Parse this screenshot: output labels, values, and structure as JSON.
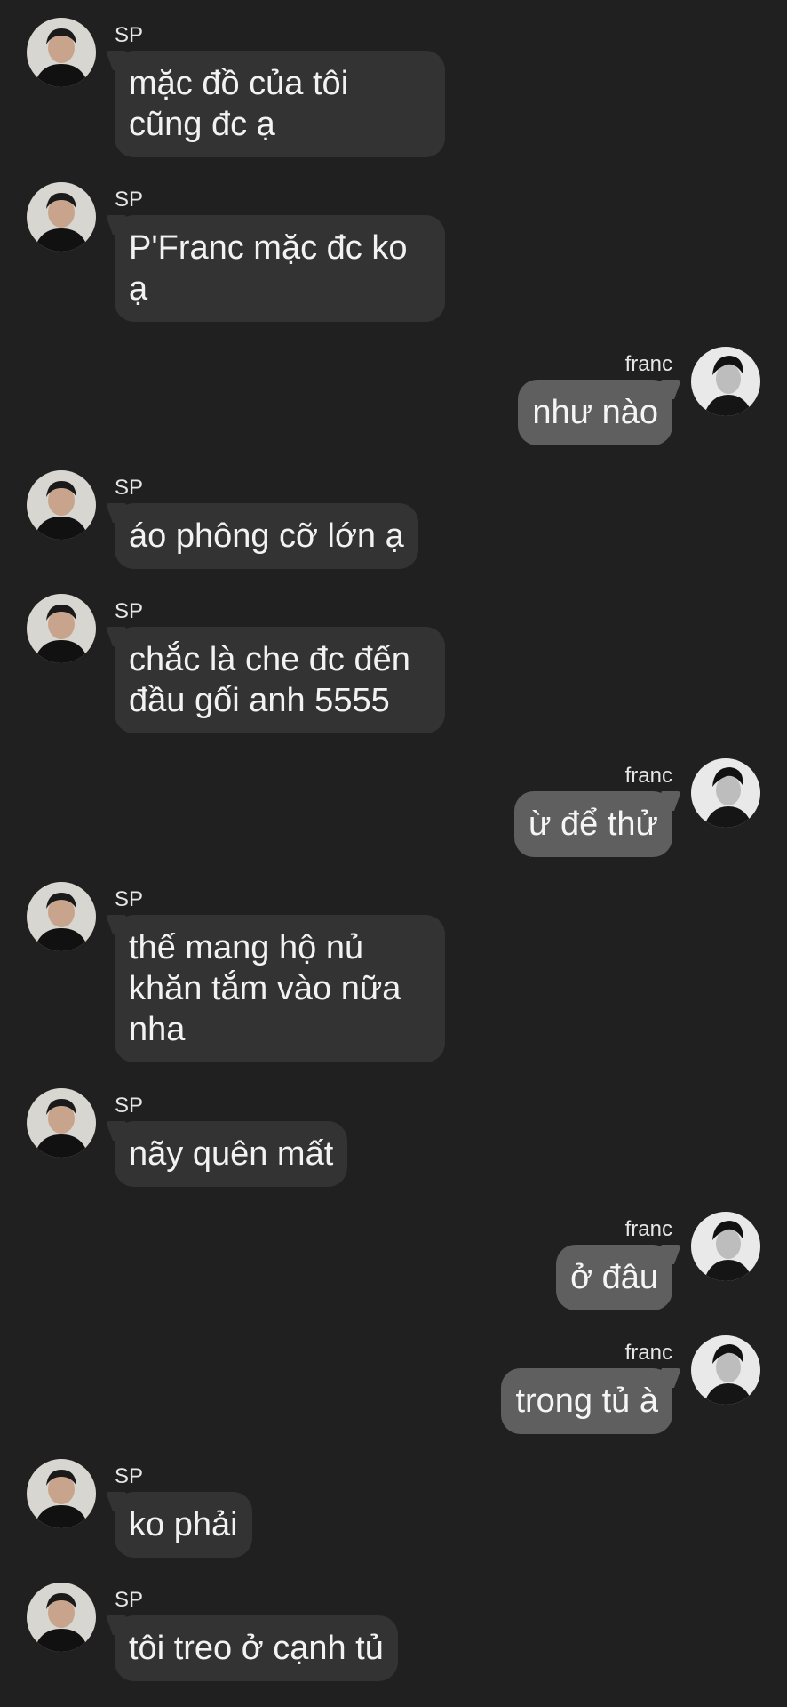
{
  "users": {
    "sp": {
      "name": "SP",
      "avatar_icon": "sp-avatar-photo"
    },
    "franc": {
      "name": "franc",
      "avatar_icon": "franc-avatar-photo"
    }
  },
  "messages": [
    {
      "from": "SP",
      "text": "mặc đồ của tôi cũng đc ạ"
    },
    {
      "from": "SP",
      "text": "P'Franc mặc đc ko ạ"
    },
    {
      "from": "franc",
      "text": "như nào"
    },
    {
      "from": "SP",
      "text": "áo phông cỡ lớn ạ"
    },
    {
      "from": "SP",
      "text": "chắc là che đc đến đầu gối anh 5555"
    },
    {
      "from": "franc",
      "text": "ừ để thử"
    },
    {
      "from": "SP",
      "text": "thế mang hộ nủ khăn tắm vào nữa nha"
    },
    {
      "from": "SP",
      "text": "nãy quên mất"
    },
    {
      "from": "franc",
      "text": "ở đâu"
    },
    {
      "from": "franc",
      "text": "trong tủ à"
    },
    {
      "from": "SP",
      "text": "ko phải"
    },
    {
      "from": "SP",
      "text": "tôi treo ở cạnh tủ"
    }
  ]
}
